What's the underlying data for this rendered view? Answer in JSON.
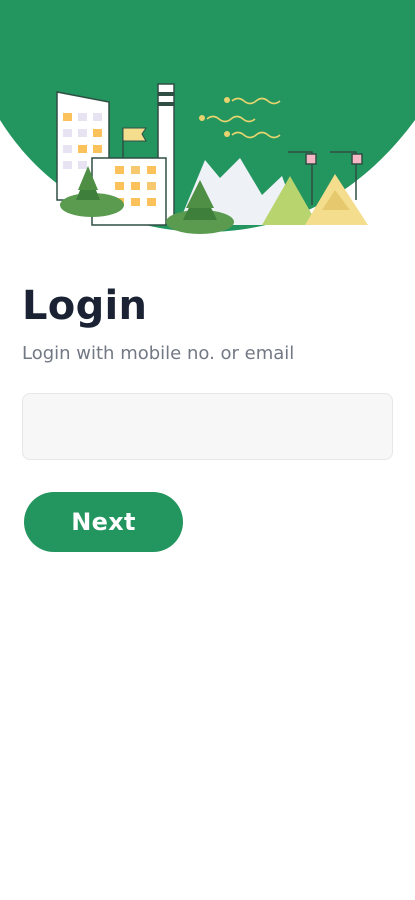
{
  "login": {
    "title": "Login",
    "subtitle": "Login with mobile no. or email",
    "input_value": "",
    "input_placeholder": "",
    "next_label": "Next"
  },
  "theme": {
    "primary": "#23955f",
    "title_color": "#1a2233",
    "subtitle_color": "#727985",
    "input_bg": "#f7f7f7"
  },
  "hero": {
    "illustration": "city-skyline-illustration"
  }
}
